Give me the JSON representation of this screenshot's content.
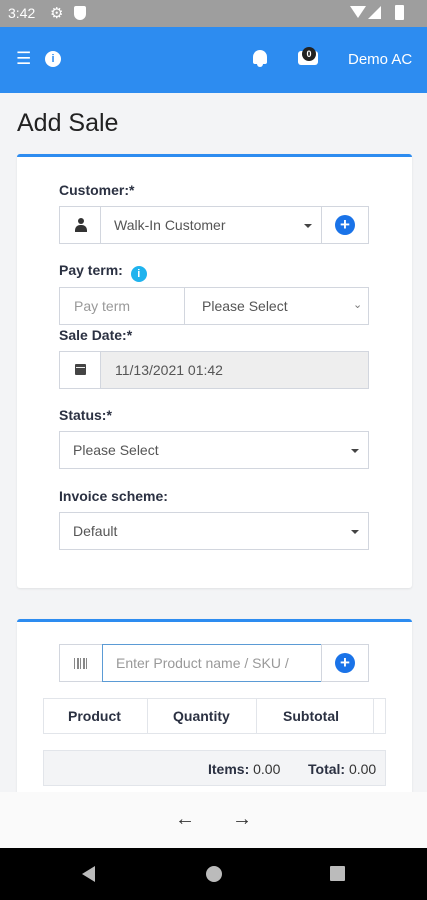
{
  "status_bar": {
    "time": "3:42"
  },
  "app_bar": {
    "cart_count": "0",
    "account_name": "Demo AC"
  },
  "page": {
    "title": "Add Sale"
  },
  "form": {
    "customer_label": "Customer:*",
    "customer_value": "Walk-In Customer",
    "pay_term_label": "Pay term:",
    "pay_term_placeholder": "Pay term",
    "pay_term_unit": "Please Select",
    "sale_date_label": "Sale Date:*",
    "sale_date_value": "11/13/2021 01:42",
    "status_label": "Status:*",
    "status_value": "Please Select",
    "invoice_label": "Invoice scheme:",
    "invoice_value": "Default"
  },
  "products": {
    "search_placeholder": "Enter Product name / SKU /",
    "columns": [
      "Product",
      "Quantity",
      "Subtotal"
    ],
    "items_label": "Items:",
    "items_value": "0.00",
    "total_label": "Total:",
    "total_value": "0.00"
  },
  "colors": {
    "accent": "#2d8cf0",
    "plus_button": "#1a73e8"
  }
}
